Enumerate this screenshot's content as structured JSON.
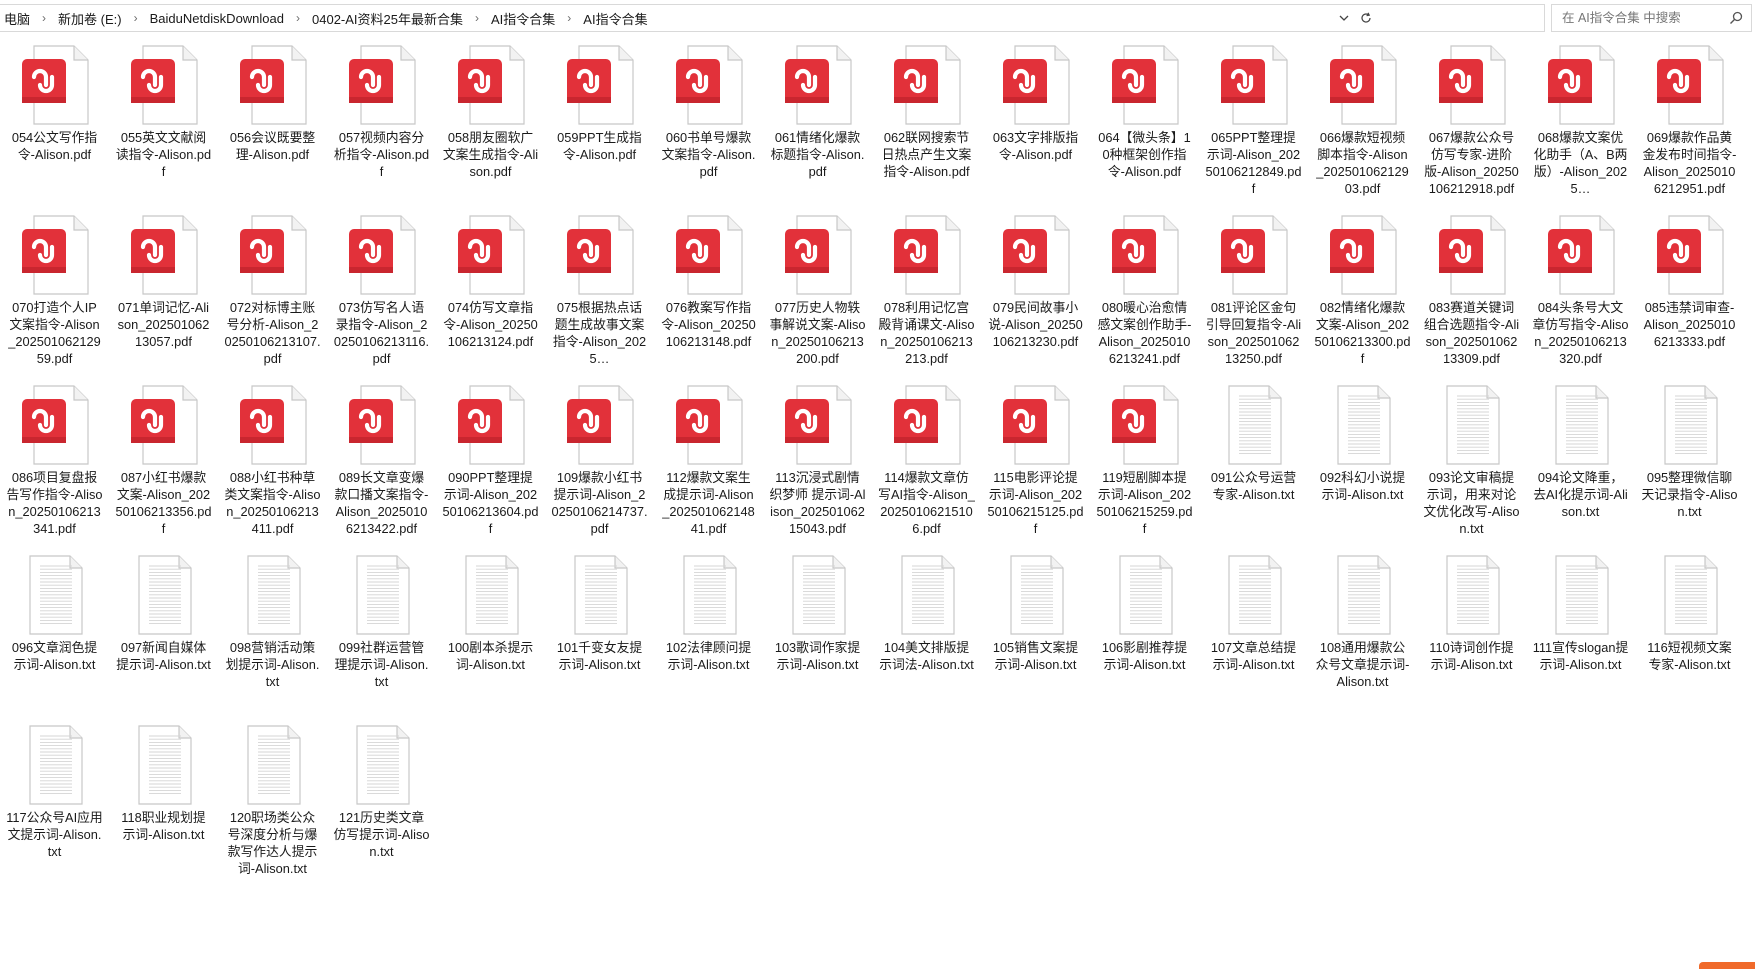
{
  "address_bar": {
    "breadcrumbs": [
      "电脑",
      "新加卷 (E:)",
      "BaiduNetdiskDownload",
      "0402-AI资料25年最新合集",
      "AI指令合集",
      "AI指令合集"
    ],
    "dropdown_icon": "chevron-down-icon",
    "refresh_icon": "refresh-icon"
  },
  "search": {
    "placeholder": "在 AI指令合集 中搜索",
    "icon": "search-icon"
  },
  "colors": {
    "pdf_red": "#e2313a",
    "pdf_red_dark": "#b91f27",
    "page_border": "#c8c8c8",
    "text_lines": "#d4d4d4"
  },
  "files": [
    {
      "name": "054公文写作指令-Alison.pdf",
      "type": "pdf"
    },
    {
      "name": "055英文文献阅读指令-Alison.pdf",
      "type": "pdf"
    },
    {
      "name": "056会议既要整理-Alison.pdf",
      "type": "pdf"
    },
    {
      "name": "057视频内容分析指令-Alison.pdf",
      "type": "pdf"
    },
    {
      "name": "058朋友圈软广文案生成指令-Alison.pdf",
      "type": "pdf"
    },
    {
      "name": "059PPT生成指令-Alison.pdf",
      "type": "pdf"
    },
    {
      "name": "060书单号爆款文案指令-Alison.pdf",
      "type": "pdf"
    },
    {
      "name": "061情绪化爆款标题指令-Alison.pdf",
      "type": "pdf"
    },
    {
      "name": "062联网搜索节日热点产生文案指令-Alison.pdf",
      "type": "pdf"
    },
    {
      "name": "063文字排版指令-Alison.pdf",
      "type": "pdf"
    },
    {
      "name": "064【微头条】10种框架创作指令-Alison.pdf",
      "type": "pdf"
    },
    {
      "name": "065PPT整理提示词-Alison_20250106212849.pdf",
      "type": "pdf"
    },
    {
      "name": "066爆款短视频脚本指令-Alison_20250106212903.pdf",
      "type": "pdf"
    },
    {
      "name": "067爆款公众号仿写专家-进阶版-Alison_20250106212918.pdf",
      "type": "pdf"
    },
    {
      "name": "068爆款文案优化助手（A、B两版）-Alison_2025…",
      "type": "pdf"
    },
    {
      "name": "069爆款作品黄金发布时间指令-Alison_20250106212951.pdf",
      "type": "pdf"
    },
    {
      "name": "070打造个人IP文案指令-Alison_20250106212959.pdf",
      "type": "pdf"
    },
    {
      "name": "071单词记忆-Alison_20250106213057.pdf",
      "type": "pdf"
    },
    {
      "name": "072对标博主账号分析-Alison_20250106213107.pdf",
      "type": "pdf"
    },
    {
      "name": "073仿写名人语录指令-Alison_20250106213116.pdf",
      "type": "pdf"
    },
    {
      "name": "074仿写文章指令-Alison_20250106213124.pdf",
      "type": "pdf"
    },
    {
      "name": "075根据热点话题生成故事文案指令-Alison_2025…",
      "type": "pdf"
    },
    {
      "name": "076教案写作指令-Alison_20250106213148.pdf",
      "type": "pdf"
    },
    {
      "name": "077历史人物轶事解说文案-Alison_20250106213200.pdf",
      "type": "pdf"
    },
    {
      "name": "078利用记忆宫殿背诵课文-Alison_20250106213213.pdf",
      "type": "pdf"
    },
    {
      "name": "079民间故事小说-Alison_20250106213230.pdf",
      "type": "pdf"
    },
    {
      "name": "080暖心治愈情感文案创作助手-Alison_20250106213241.pdf",
      "type": "pdf"
    },
    {
      "name": "081评论区金句引导回复指令-Alison_20250106213250.pdf",
      "type": "pdf"
    },
    {
      "name": "082情绪化爆款文案-Alison_20250106213300.pdf",
      "type": "pdf"
    },
    {
      "name": "083赛道关键词组合选题指令-Alison_20250106213309.pdf",
      "type": "pdf"
    },
    {
      "name": "084头条号大文章仿写指令-Alison_20250106213320.pdf",
      "type": "pdf"
    },
    {
      "name": "085违禁词审查-Alison_20250106213333.pdf",
      "type": "pdf"
    },
    {
      "name": "086项目复盘报告写作指令-Alison_20250106213341.pdf",
      "type": "pdf"
    },
    {
      "name": "087小红书爆款文案-Alison_20250106213356.pdf",
      "type": "pdf"
    },
    {
      "name": "088小红书种草类文案指令-Alison_20250106213411.pdf",
      "type": "pdf"
    },
    {
      "name": "089长文章变爆款口播文案指令-Alison_20250106213422.pdf",
      "type": "pdf"
    },
    {
      "name": "090PPT整理提示词-Alison_20250106213604.pdf",
      "type": "pdf"
    },
    {
      "name": "109爆款小红书提示词-Alison_20250106214737.pdf",
      "type": "pdf"
    },
    {
      "name": "112爆款文案生成提示词-Alison_20250106214841.pdf",
      "type": "pdf"
    },
    {
      "name": "113沉浸式剧情织梦师 提示词-Alison_20250106215043.pdf",
      "type": "pdf"
    },
    {
      "name": "114爆款文章仿写AI指令-Alison_20250106215106.pdf",
      "type": "pdf"
    },
    {
      "name": "115电影评论提示词-Alison_20250106215125.pdf",
      "type": "pdf"
    },
    {
      "name": "119短剧脚本提示词-Alison_20250106215259.pdf",
      "type": "pdf"
    },
    {
      "name": "091公众号运营专家-Alison.txt",
      "type": "txt"
    },
    {
      "name": "092科幻小说提示词-Alison.txt",
      "type": "txt"
    },
    {
      "name": "093论文审稿提示词，用来对论文优化改写-Alison.txt",
      "type": "txt"
    },
    {
      "name": "094论文降重，去AI化提示词-Alison.txt",
      "type": "txt"
    },
    {
      "name": "095整理微信聊天记录指令-Alison.txt",
      "type": "txt"
    },
    {
      "name": "096文章润色提示词-Alison.txt",
      "type": "txt"
    },
    {
      "name": "097新闻自媒体提示词-Alison.txt",
      "type": "txt"
    },
    {
      "name": "098营销活动策划提示词-Alison.txt",
      "type": "txt"
    },
    {
      "name": "099社群运营管理提示词-Alison.txt",
      "type": "txt"
    },
    {
      "name": "100剧本杀提示词-Alison.txt",
      "type": "txt"
    },
    {
      "name": "101千变女友提示词-Alison.txt",
      "type": "txt"
    },
    {
      "name": "102法律顾问提示词-Alison.txt",
      "type": "txt"
    },
    {
      "name": "103歌词作家提示词-Alison.txt",
      "type": "txt"
    },
    {
      "name": "104美文排版提示词法-Alison.txt",
      "type": "txt"
    },
    {
      "name": "105销售文案提示词-Alison.txt",
      "type": "txt"
    },
    {
      "name": "106影剧推荐提示词-Alison.txt",
      "type": "txt"
    },
    {
      "name": "107文章总结提示词-Alison.txt",
      "type": "txt"
    },
    {
      "name": "108通用爆款公众号文章提示词-Alison.txt",
      "type": "txt"
    },
    {
      "name": "110诗词创作提示词-Alison.txt",
      "type": "txt"
    },
    {
      "name": "111宣传slogan提示词-Alison.txt",
      "type": "txt"
    },
    {
      "name": "116短视频文案专家-Alison.txt",
      "type": "txt"
    },
    {
      "name": "117公众号AI应用文提示词-Alison.txt",
      "type": "txt"
    },
    {
      "name": "118职业规划提示词-Alison.txt",
      "type": "txt"
    },
    {
      "name": "120职场类公众号深度分析与爆款写作达人提示词-Alison.txt",
      "type": "txt"
    },
    {
      "name": "121历史类文章仿写提示词-Alison.txt",
      "type": "txt"
    }
  ]
}
